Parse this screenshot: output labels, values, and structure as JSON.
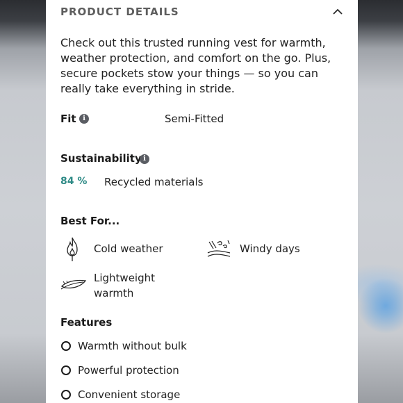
{
  "product_details": {
    "title": "PRODUCT DETAILS",
    "description": "Check out this trusted running vest for warmth, weather protection, and comfort on the go. Plus, secure pockets stow your things — so you can really take everything in stride.",
    "fit": {
      "label": "Fit",
      "value": "Semi-Fitted"
    },
    "sustainability": {
      "label": "Sustainability",
      "percent": "84 %",
      "text": "Recycled materials",
      "accent_color": "#2e8a86"
    },
    "best_for": {
      "label": "Best For...",
      "items": [
        {
          "icon": "flame-icon",
          "label": "Cold weather"
        },
        {
          "icon": "wind-icon",
          "label": "Windy days"
        },
        {
          "icon": "feather-icon",
          "label_line1": "Lightweight",
          "label_line2": "warmth"
        }
      ]
    },
    "features": {
      "label": "Features",
      "items": [
        "Warmth without bulk",
        "Powerful protection",
        "Convenient storage"
      ]
    }
  }
}
